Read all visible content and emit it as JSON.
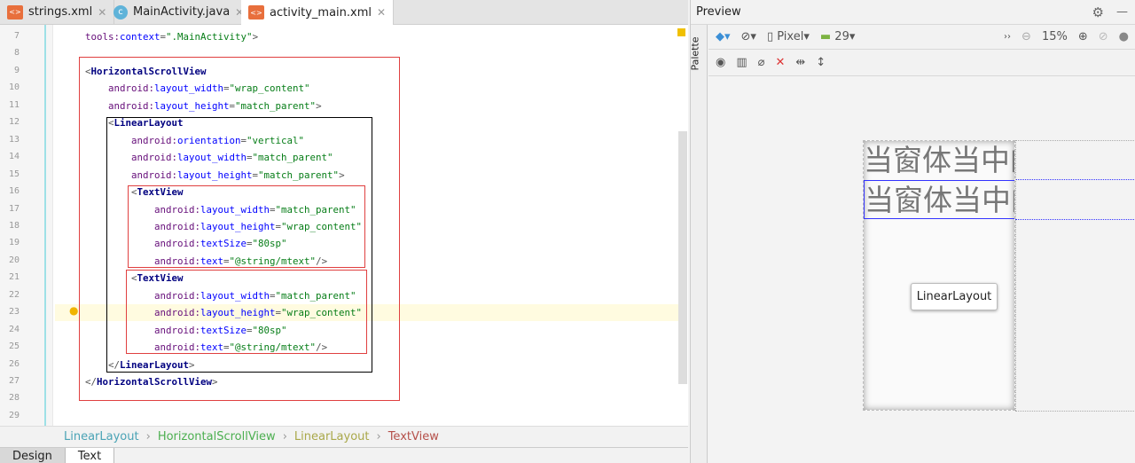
{
  "tabs": [
    {
      "label": "strings.xml",
      "icon": "xml-file-icon"
    },
    {
      "label": "MainActivity.java",
      "icon": "java-class-icon"
    },
    {
      "label": "activity_main.xml",
      "icon": "xml-file-icon",
      "active": true
    }
  ],
  "code": [
    {
      "n": "7",
      "indent": 1,
      "tokens": [
        [
          "a",
          "tools:"
        ],
        [
          "n",
          "context"
        ],
        [
          "p",
          "="
        ],
        [
          "v",
          "\".MainActivity\""
        ],
        [
          "p",
          ">"
        ]
      ]
    },
    {
      "n": "8",
      "indent": 0,
      "tokens": []
    },
    {
      "n": "9",
      "indent": 1,
      "tokens": [
        [
          "p",
          "<"
        ],
        [
          "t",
          "HorizontalScrollView"
        ]
      ]
    },
    {
      "n": "10",
      "indent": 2,
      "tokens": [
        [
          "a",
          "android:"
        ],
        [
          "n",
          "layout_width"
        ],
        [
          "p",
          "="
        ],
        [
          "v",
          "\"wrap_content\""
        ]
      ]
    },
    {
      "n": "11",
      "indent": 2,
      "tokens": [
        [
          "a",
          "android:"
        ],
        [
          "n",
          "layout_height"
        ],
        [
          "p",
          "="
        ],
        [
          "v",
          "\"match_parent\""
        ],
        [
          "p",
          ">"
        ]
      ]
    },
    {
      "n": "12",
      "indent": 2,
      "tokens": [
        [
          "p",
          "<"
        ],
        [
          "t",
          "LinearLayout"
        ]
      ]
    },
    {
      "n": "13",
      "indent": 3,
      "tokens": [
        [
          "a",
          "android:"
        ],
        [
          "n",
          "orientation"
        ],
        [
          "p",
          "="
        ],
        [
          "v",
          "\"vertical\""
        ]
      ]
    },
    {
      "n": "14",
      "indent": 3,
      "tokens": [
        [
          "a",
          "android:"
        ],
        [
          "n",
          "layout_width"
        ],
        [
          "p",
          "="
        ],
        [
          "v",
          "\"match_parent\""
        ]
      ]
    },
    {
      "n": "15",
      "indent": 3,
      "tokens": [
        [
          "a",
          "android:"
        ],
        [
          "n",
          "layout_height"
        ],
        [
          "p",
          "="
        ],
        [
          "v",
          "\"match_parent\""
        ],
        [
          "p",
          ">"
        ]
      ]
    },
    {
      "n": "16",
      "indent": 3,
      "tokens": [
        [
          "p",
          "<"
        ],
        [
          "t",
          "TextView"
        ]
      ]
    },
    {
      "n": "17",
      "indent": 4,
      "tokens": [
        [
          "a",
          "android:"
        ],
        [
          "n",
          "layout_width"
        ],
        [
          "p",
          "="
        ],
        [
          "v",
          "\"match_parent\""
        ]
      ]
    },
    {
      "n": "18",
      "indent": 4,
      "tokens": [
        [
          "a",
          "android:"
        ],
        [
          "n",
          "layout_height"
        ],
        [
          "p",
          "="
        ],
        [
          "v",
          "\"wrap_content\""
        ]
      ]
    },
    {
      "n": "19",
      "indent": 4,
      "tokens": [
        [
          "a",
          "android:"
        ],
        [
          "n",
          "textSize"
        ],
        [
          "p",
          "="
        ],
        [
          "v",
          "\"80sp\""
        ]
      ]
    },
    {
      "n": "20",
      "indent": 4,
      "tokens": [
        [
          "a",
          "android:"
        ],
        [
          "n",
          "text"
        ],
        [
          "p",
          "="
        ],
        [
          "v",
          "\"@string/mtext\""
        ],
        [
          "p",
          "/>"
        ]
      ]
    },
    {
      "n": "21",
      "indent": 3,
      "tokens": [
        [
          "p",
          "<"
        ],
        [
          "t",
          "TextView"
        ]
      ]
    },
    {
      "n": "22",
      "indent": 4,
      "tokens": [
        [
          "a",
          "android:"
        ],
        [
          "n",
          "layout_width"
        ],
        [
          "p",
          "="
        ],
        [
          "v",
          "\"match_parent\""
        ]
      ]
    },
    {
      "n": "23",
      "indent": 4,
      "tokens": [
        [
          "a",
          "android:"
        ],
        [
          "n",
          "layout_height"
        ],
        [
          "p",
          "="
        ],
        [
          "v",
          "\"wrap_content\""
        ]
      ]
    },
    {
      "n": "24",
      "indent": 4,
      "tokens": [
        [
          "a",
          "android:"
        ],
        [
          "n",
          "textSize"
        ],
        [
          "p",
          "="
        ],
        [
          "v",
          "\"80sp\""
        ]
      ]
    },
    {
      "n": "25",
      "indent": 4,
      "tokens": [
        [
          "a",
          "android:"
        ],
        [
          "n",
          "text"
        ],
        [
          "p",
          "="
        ],
        [
          "v",
          "\"@string/mtext\""
        ],
        [
          "p",
          "/>"
        ]
      ]
    },
    {
      "n": "26",
      "indent": 2,
      "tokens": [
        [
          "p",
          "</"
        ],
        [
          "t",
          "LinearLayout"
        ],
        [
          "p",
          ">"
        ]
      ]
    },
    {
      "n": "27",
      "indent": 1,
      "tokens": [
        [
          "p",
          "</"
        ],
        [
          "t",
          "HorizontalScrollView"
        ],
        [
          "p",
          ">"
        ]
      ]
    },
    {
      "n": "28",
      "indent": 0,
      "tokens": []
    },
    {
      "n": "29",
      "indent": 0,
      "tokens": []
    }
  ],
  "breadcrumbs": [
    {
      "label": "LinearLayout",
      "color": "#4aa3b5"
    },
    {
      "label": "HorizontalScrollView",
      "color": "#4caf50"
    },
    {
      "label": "LinearLayout",
      "color": "#a9a84a"
    },
    {
      "label": "TextView",
      "color": "#b5504a"
    }
  ],
  "bottom_tabs": [
    "Design",
    "Text"
  ],
  "preview": {
    "title": "Preview",
    "palette": "Palette",
    "device": "Pixel",
    "api": "29",
    "zoom": "15%",
    "tooltip": "LinearLayout",
    "text_views": [
      "当窗体当中的",
      "当窗体当中的"
    ]
  }
}
